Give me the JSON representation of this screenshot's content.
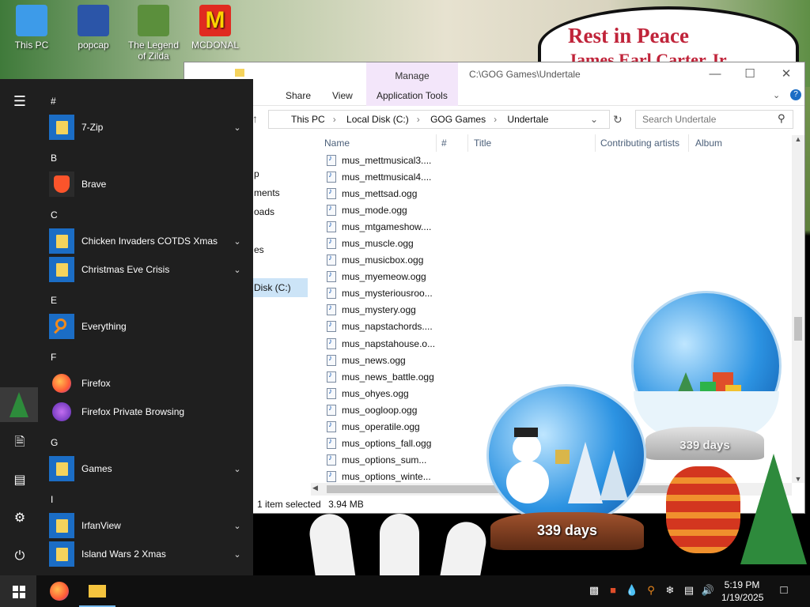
{
  "desktop": {
    "icons": [
      {
        "label": "This PC",
        "color": "#3d9be9"
      },
      {
        "label": "popcap",
        "color": "#2b55a8"
      },
      {
        "label": "The Legend of Zilda",
        "color": "#5b8f3c"
      },
      {
        "label": "MCDONAL",
        "color": "#e02b20"
      }
    ],
    "sign_title": "Rest in Peace",
    "sign_subtitle": "James Earl Carter Jr"
  },
  "explorer": {
    "ribbon_manage": "Manage",
    "title_path": "C:\\GOG Games\\Undertale",
    "tabs": [
      "Share",
      "View",
      "Application Tools"
    ],
    "address": [
      "This PC",
      "Local Disk (C:)",
      "GOG Games",
      "Undertale"
    ],
    "search_placeholder": "Search Undertale",
    "columns": [
      "Name",
      "#",
      "Title",
      "Contributing artists",
      "Album"
    ],
    "nav_pane": [
      "p",
      "ments",
      "oads",
      "es",
      "Disk (C:)",
      "",
      ""
    ],
    "files": [
      "mus_mettmusical3....",
      "mus_mettmusical4....",
      "mus_mettsad.ogg",
      "mus_mode.ogg",
      "mus_mtgameshow....",
      "mus_muscle.ogg",
      "mus_musicbox.ogg",
      "mus_myemeow.ogg",
      "mus_mysteriousroo...",
      "mus_mystery.ogg",
      "mus_napstachords....",
      "mus_napstahouse.o...",
      "mus_news.ogg",
      "mus_news_battle.ogg",
      "mus_ohyes.ogg",
      "mus_oogloop.ogg",
      "mus_operatile.ogg",
      "mus_options_fall.ogg",
      "mus_options_sum...",
      "mus_options_winte..."
    ],
    "status_selected": "1 item selected",
    "status_size": "3.94 MB"
  },
  "start_menu": {
    "letters": {
      "hash": "#",
      "b": "B",
      "c": "C",
      "e": "E",
      "f": "F",
      "g": "G",
      "i": "I"
    },
    "apps": {
      "sevenzip": "7-Zip",
      "brave": "Brave",
      "chicken": "Chicken Invaders COTDS Xmas",
      "christmas": "Christmas Eve Crisis",
      "everything": "Everything",
      "firefox": "Firefox",
      "firefox_private": "Firefox Private Browsing",
      "games": "Games",
      "irfanview": "IrfanView",
      "islandwars": "Island Wars 2 Xmas"
    }
  },
  "widgets": {
    "globe_small_days": "339 days",
    "globe_big_days": "339 days"
  },
  "taskbar": {
    "time": "5:19 PM",
    "date": "1/19/2025"
  },
  "colors": {
    "accent_blue": "#1b6dc5",
    "manage_tab": "#f3e6fa",
    "start_bg": "#1f1f1f",
    "taskbar_bg": "#101010"
  }
}
